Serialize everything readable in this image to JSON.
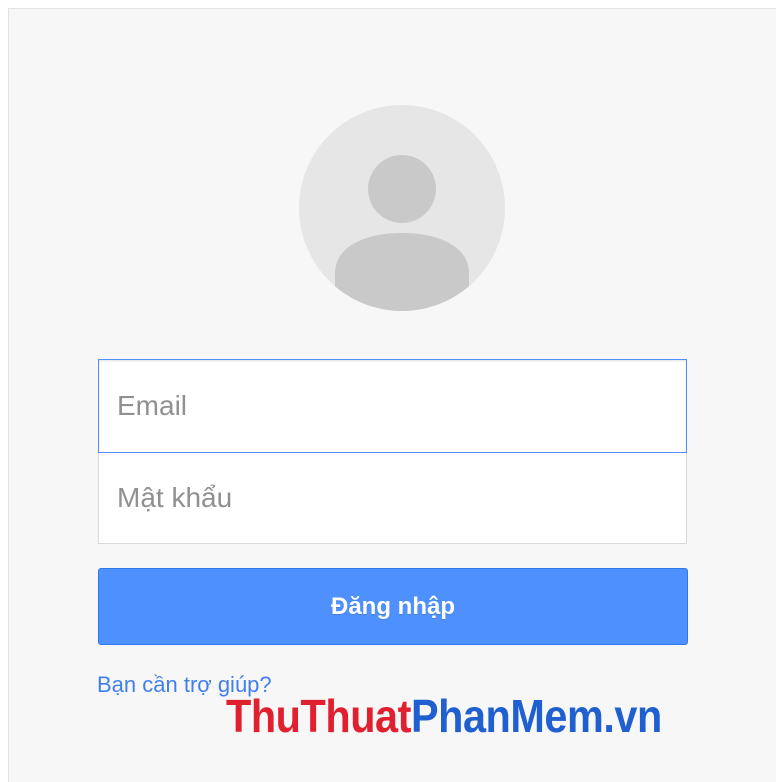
{
  "login": {
    "email_placeholder": "Email",
    "password_placeholder": "Mật khẩu",
    "signin_label": "Đăng nhập",
    "help_link": "Bạn cần trợ giúp?"
  },
  "watermark": {
    "part1": "ThuThuat",
    "part2": "PhanMem.vn"
  },
  "icons": {
    "avatar": "user-avatar-icon"
  },
  "colors": {
    "primary_button": "#4d90fe",
    "link": "#427fed",
    "focus_border": "#4d90fe",
    "card_background": "#f7f7f7",
    "watermark_red": "#e0202e",
    "watermark_blue": "#1f5fd0"
  }
}
